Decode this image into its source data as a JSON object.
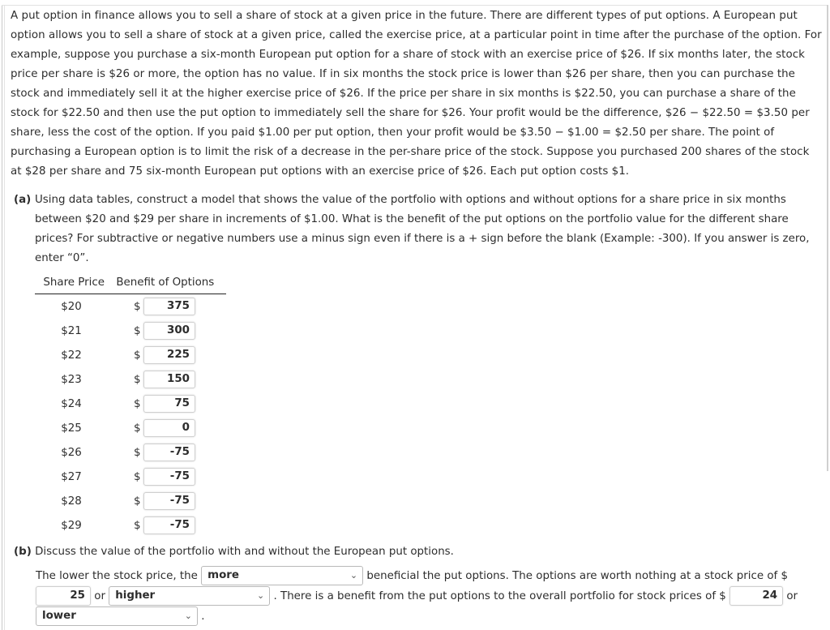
{
  "intro": {
    "paragraph": "A put option in finance allows you to sell a share of stock at a given price in the future. There are different types of put options. A European put option allows you to sell a share of stock at a given price, called the exercise price, at a particular point in time after the purchase of the option. For example, suppose you purchase a six-month European put option for a share of stock with an exercise price of $26. If six months later, the stock price per share is $26 or more, the option has no value. If in six months the stock price is lower than $26 per share, then you can purchase the stock and immediately sell it at the higher exercise price of $26. If the price per share in six months is $22.50, you can purchase a share of the stock for $22.50 and then use the put option to immediately sell the share for $26. Your profit would be the difference, $26 − $22.50 = $3.50 per share, less the cost of the option. If you paid $1.00 per put option, then your profit would be $3.50 − $1.00 = $2.50 per share. The point of purchasing a European option is to limit the risk of a decrease in the per-share price of the stock. Suppose you purchased 200 shares of the stock at $28 per share and 75 six-month European put options with an exercise price of $26. Each put option costs $1."
  },
  "part_a": {
    "label": "(a)",
    "text": "Using data tables, construct a model that shows the value of the portfolio with options and without options for a share price in six months between $20 and $29 per share in increments of $1.00. What is the benefit of the put options on the portfolio value for the different share prices? For subtractive or negative numbers use a minus sign even if there is a + sign before the blank (Example: -300). If you answer is zero, enter “0”.",
    "table": {
      "headers": [
        "Share Price",
        "Benefit of Options"
      ],
      "currency_symbol": "$",
      "rows": [
        {
          "price": "$20",
          "benefit": "375"
        },
        {
          "price": "$21",
          "benefit": "300"
        },
        {
          "price": "$22",
          "benefit": "225"
        },
        {
          "price": "$23",
          "benefit": "150"
        },
        {
          "price": "$24",
          "benefit": "75"
        },
        {
          "price": "$25",
          "benefit": "0"
        },
        {
          "price": "$26",
          "benefit": "-75"
        },
        {
          "price": "$27",
          "benefit": "-75"
        },
        {
          "price": "$28",
          "benefit": "-75"
        },
        {
          "price": "$29",
          "benefit": "-75"
        }
      ]
    }
  },
  "part_b": {
    "label": "(b)",
    "text": "Discuss the value of the portfolio with and without the European put options.",
    "line1_prefix": "The lower the stock price, the",
    "select1_value": "more",
    "line1_suffix": "beneficial the put options. The options are worth nothing at a stock price of $",
    "input1_value": "25",
    "or_text": "or",
    "select2_value": "higher",
    "line2_suffix": ". There is a benefit from the put options to the overall portfolio for stock prices of $",
    "input2_value": "24",
    "or_text2": "or",
    "select3_value": "lower",
    "period": "."
  },
  "icons": {
    "chevron": "⌄"
  }
}
